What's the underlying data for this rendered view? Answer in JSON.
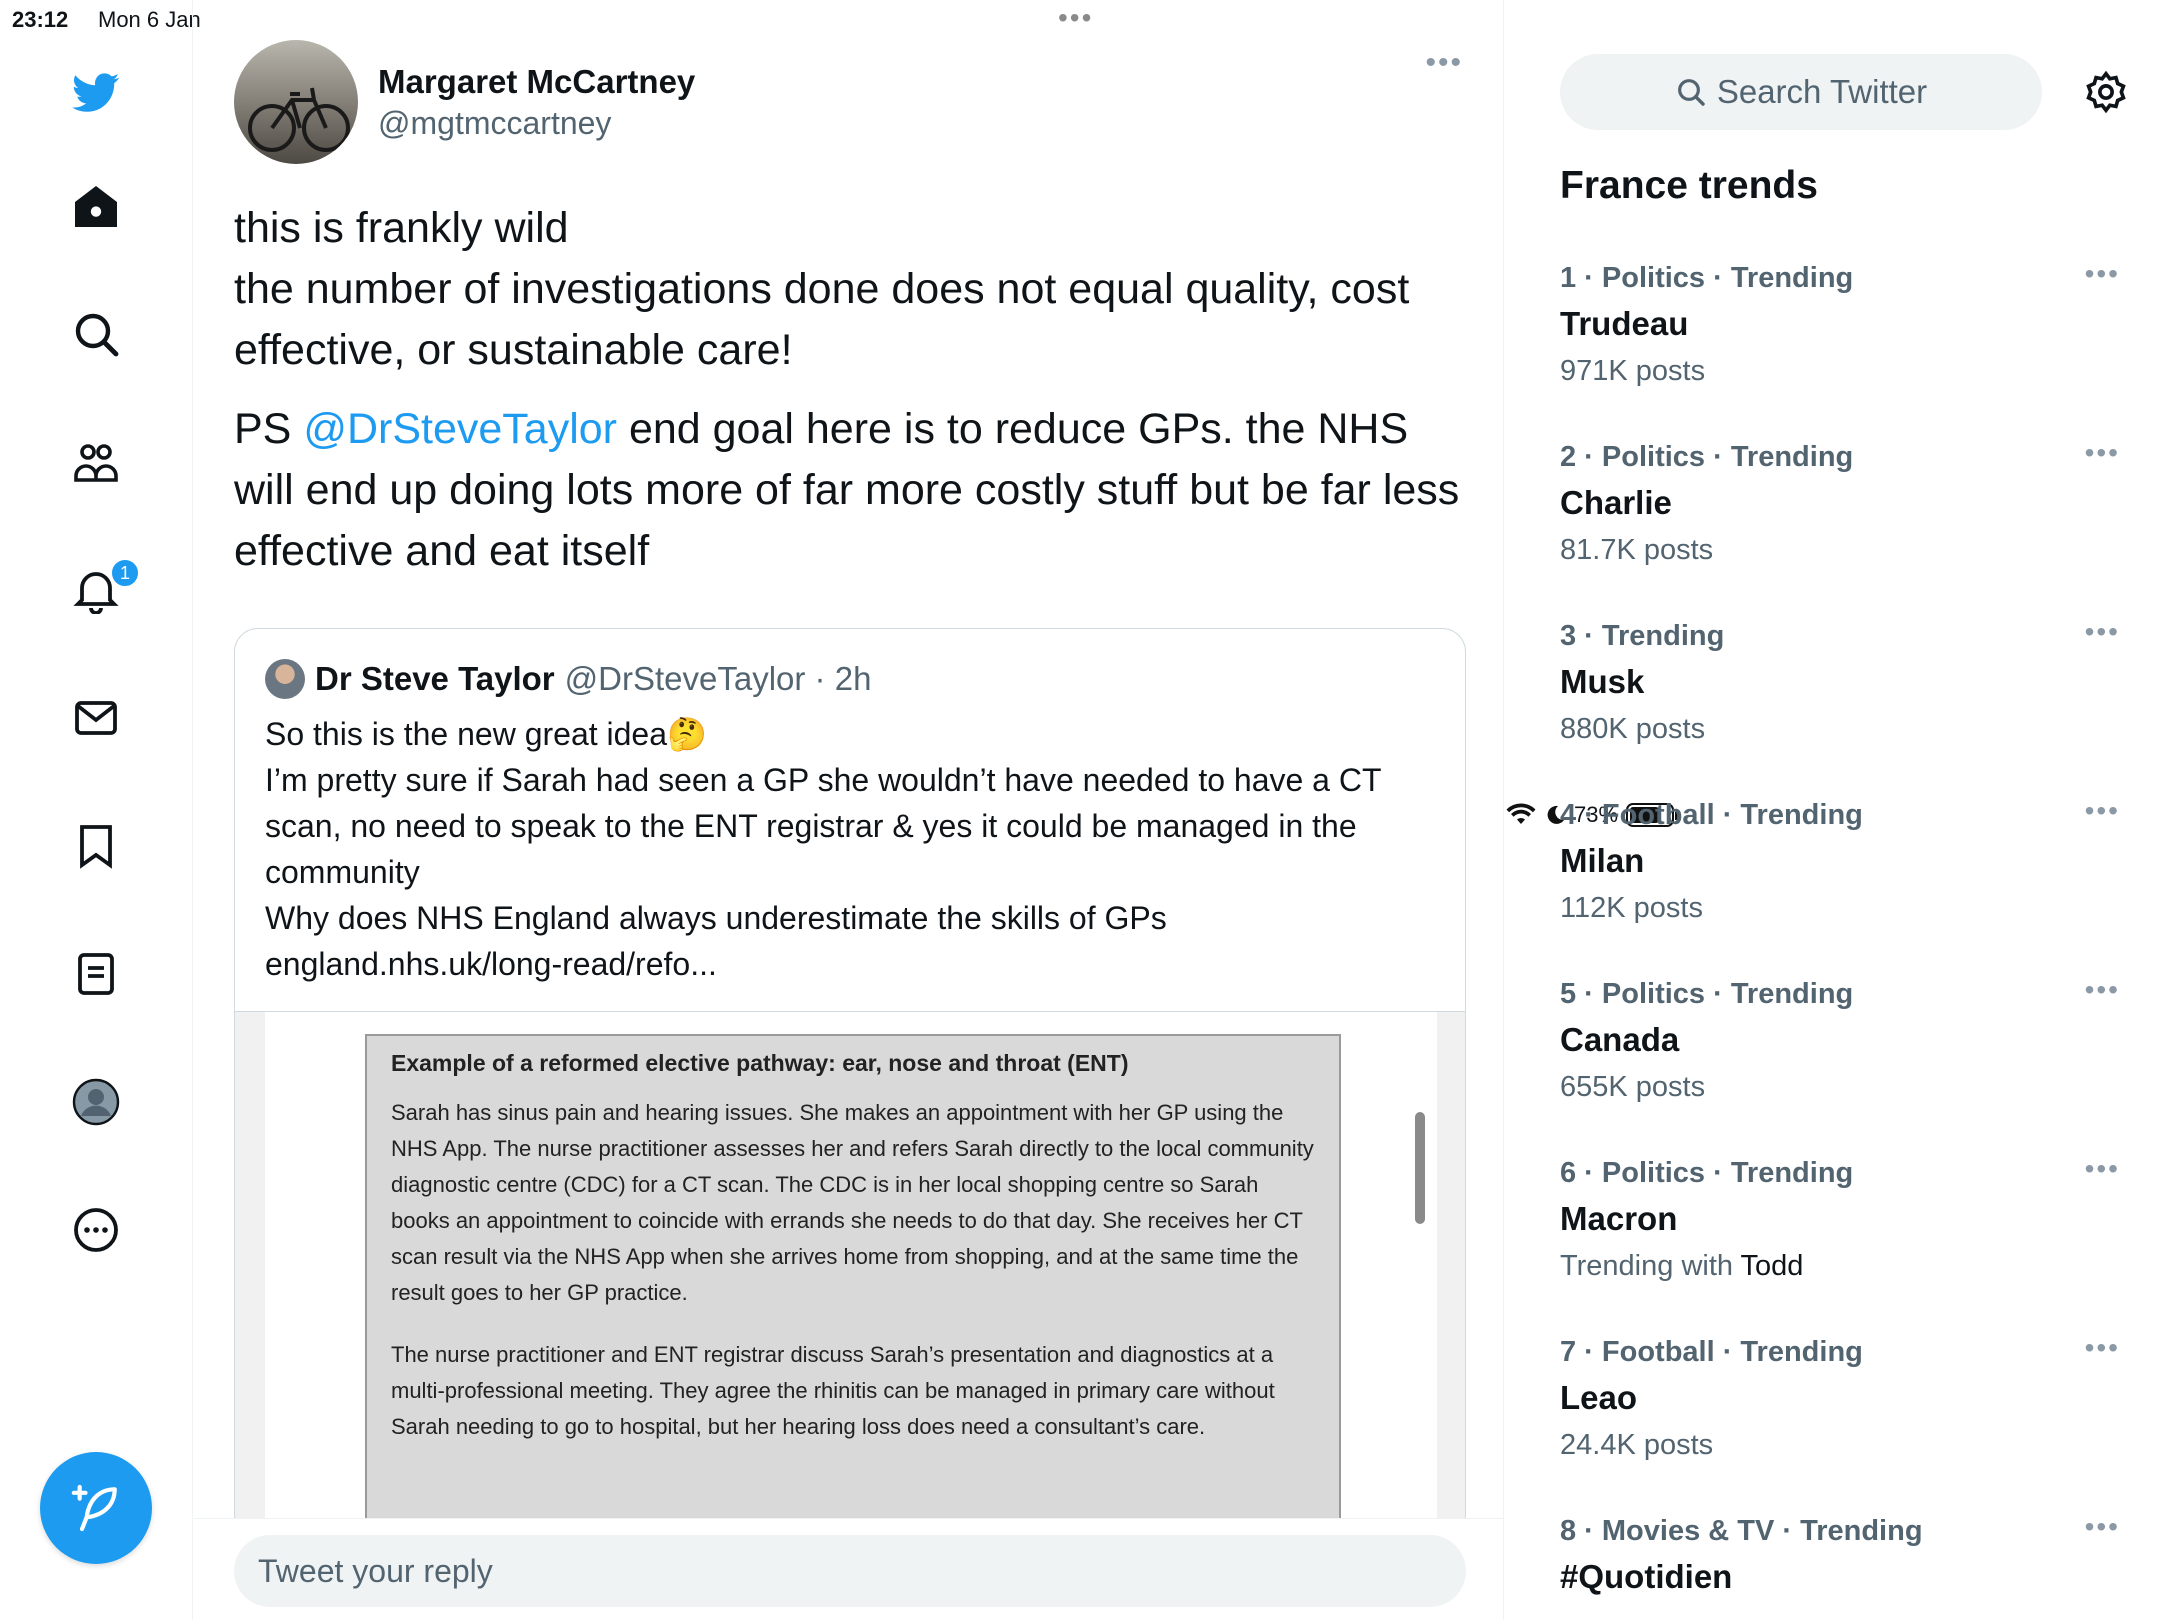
{
  "status_bar": {
    "time": "23:12",
    "date": "Mon 6 Jan",
    "battery": "73%",
    "battery_level": 0.73
  },
  "nav": {
    "notification_count": "1"
  },
  "tweet": {
    "author_name": "Margaret McCartney",
    "author_handle": "@mgtmccartney",
    "more": "•••",
    "line1": "this is frankly wild",
    "line2": "the number of investigations done does not equal quality, cost effective, or sustainable care!",
    "ps_prefix": "PS ",
    "mention": "@DrSteveTaylor",
    "ps_rest": " end goal here is to reduce GPs.  the NHS will end up doing lots more of far more costly stuff but be far less effective and eat itself"
  },
  "quote": {
    "name": "Dr Steve Taylor",
    "handle_time": "@DrSteveTaylor · 2h",
    "line1": "So this is the new great idea🤔",
    "line2": "I’m pretty sure if Sarah had seen a GP she wouldn’t have needed to have a CT scan, no need to speak to the ENT registrar & yes it could be managed in the community",
    "line3": "Why does NHS England always underestimate the skills of GPs",
    "link": "england.nhs.uk/long-read/refo...",
    "doc_title": "Example of a reformed elective pathway: ear, nose and throat (ENT)",
    "doc_para1": "Sarah has sinus pain and hearing issues. She makes an appointment with her GP using the NHS App. The nurse practitioner assesses her and refers Sarah directly to the local community diagnostic centre (CDC) for a CT scan. The CDC is in her local shopping centre so Sarah books an appointment to coincide with errands she needs to do that day. She receives her CT scan result via the NHS App when she arrives home from shopping, and at the same time the result goes to her GP practice.",
    "doc_para2": "The nurse practitioner and ENT registrar discuss Sarah’s presentation and diagnostics at a multi-professional meeting. They agree the rhinitis can be managed in primary care without Sarah needing to go to hospital, but her hearing loss does need a consultant’s care."
  },
  "reply": {
    "placeholder": "Tweet your reply"
  },
  "sidebar": {
    "search_placeholder": "Search Twitter",
    "trends_title": "France trends",
    "trends": [
      {
        "meta": "1 · Politics · Trending",
        "name": "Trudeau",
        "posts": "971K posts"
      },
      {
        "meta": "2 · Politics · Trending",
        "name": "Charlie",
        "posts": "81.7K posts"
      },
      {
        "meta": "3 · Trending",
        "name": "Musk",
        "posts": "880K posts"
      },
      {
        "meta": "4 · Football · Trending",
        "name": "Milan",
        "posts": "112K posts"
      },
      {
        "meta": "5 · Politics · Trending",
        "name": "Canada",
        "posts": "655K posts"
      },
      {
        "meta": "6 · Politics · Trending",
        "name": "Macron",
        "posts_prefix": "Trending with ",
        "posts_with": "Todd"
      },
      {
        "meta": "7 · Football · Trending",
        "name": "Leao",
        "posts": "24.4K posts"
      },
      {
        "meta": "8 · Movies & TV · Trending",
        "name": "#Quotidien",
        "posts": ""
      }
    ],
    "more": "•••"
  },
  "colors": {
    "accent": "#1d9bf0",
    "text": "#0f1419",
    "secondary": "#536471"
  },
  "icons": [
    "twitter-logo-icon",
    "home-icon",
    "search-icon",
    "communities-icon",
    "notifications-icon",
    "messages-icon",
    "bookmarks-icon",
    "lists-icon",
    "profile-icon",
    "more-icon",
    "compose-icon",
    "settings-icon",
    "wifi-icon",
    "moon-icon",
    "battery-icon"
  ]
}
